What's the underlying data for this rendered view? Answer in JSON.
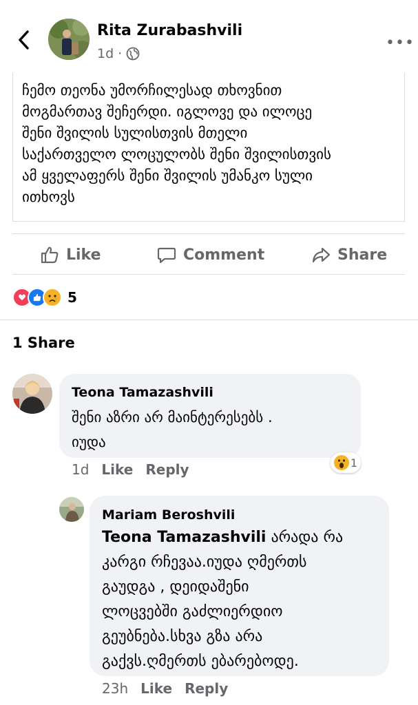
{
  "header": {
    "author": "Rita Zurabashvili",
    "time": "1d",
    "dot": "·",
    "more_label": "•••"
  },
  "post": {
    "text": "ჩემო თეონა უმორჩილესად თხოვნით\nმოგმართავ შეჩერდი. იგლოვე და ილოცე\nშენი შვილის სულისთვის მთელი\nსაქართველო ლოცულობს შენი შვილისთვის\nამ ყველაფერს შენი შვილის უმანკო სული\nითხოვს"
  },
  "actions": {
    "like": "Like",
    "comment": "Comment",
    "share": "Share"
  },
  "reactions": {
    "count": "5",
    "types": [
      "heart-icon",
      "like-icon",
      "sad-icon"
    ]
  },
  "shares_label": "1 Share",
  "comments": [
    {
      "author": "Teona Tamazashvili",
      "text": "შენი აზრი არ მაინტერესებს .\nიუდა",
      "time": "1d",
      "like": "Like",
      "reply": "Reply",
      "reaction_count": "1"
    },
    {
      "author": "Mariam Beroshvili",
      "mention": "Teona Tamazashvili",
      "text_first": " არადა რა",
      "text_rest": "კარგი რჩევაა.იუდა ღმერთს\nგაუდგა , დეიდაშენი\nლოცვებში გაძლიერდიო\nგეუბნება.სხვა გზა არა\nგაქვს.ღმერთს ებარებოდე.",
      "time": "23h",
      "like": "Like",
      "reply": "Reply"
    }
  ],
  "colors": {
    "primary_text": "#050505",
    "secondary_text": "#65676b",
    "bubble": "#f0f2f5",
    "divider": "#dadde1",
    "like_blue": "#1877f2",
    "love_red": "#f33e58",
    "haha_yellow": "#f7b125"
  }
}
